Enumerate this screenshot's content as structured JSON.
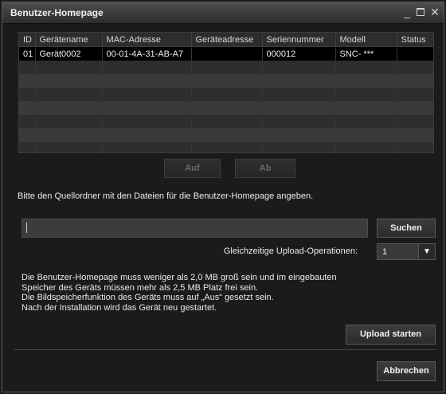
{
  "window": {
    "title": "Benutzer-Homepage",
    "controls": {
      "minimize": "_",
      "maximize": "",
      "close": "✕"
    }
  },
  "table": {
    "columns": [
      "ID",
      "Gerätename",
      "MAC-Adresse",
      "Geräteadresse",
      "Seriennummer",
      "Modell",
      "Status"
    ],
    "rows": [
      {
        "id": "01",
        "name": "Gerät0002",
        "mac": "00-01-4A-31-AB-A7",
        "address": "",
        "serial": "000012",
        "model": "SNC- ***",
        "status": ""
      }
    ],
    "empty_rows": 7
  },
  "buttons": {
    "up": "Auf",
    "down": "Ab",
    "search": "Suchen",
    "upload": "Upload starten",
    "cancel": "Abbrechen"
  },
  "instruction": "Bitte den Quellordner mit den Dateien für die Benutzer-Homepage angeben.",
  "source_path": {
    "value": "",
    "placeholder": ""
  },
  "concurrent": {
    "label": "Gleichzeitige Upload-Operationen:",
    "value": "1",
    "arrow_icon": "triangle-down"
  },
  "notes": [
    "Die Benutzer-Homepage muss weniger als 2,0 MB groß sein und im eingebauten",
    "Speicher des Geräts müssen mehr als 2,5 MB Platz frei sein.",
    "Die Bildspeicherfunktion des Geräts muss auf „Aus“ gesetzt sein.",
    "Nach der Installation wird das Gerät neu gestartet."
  ]
}
